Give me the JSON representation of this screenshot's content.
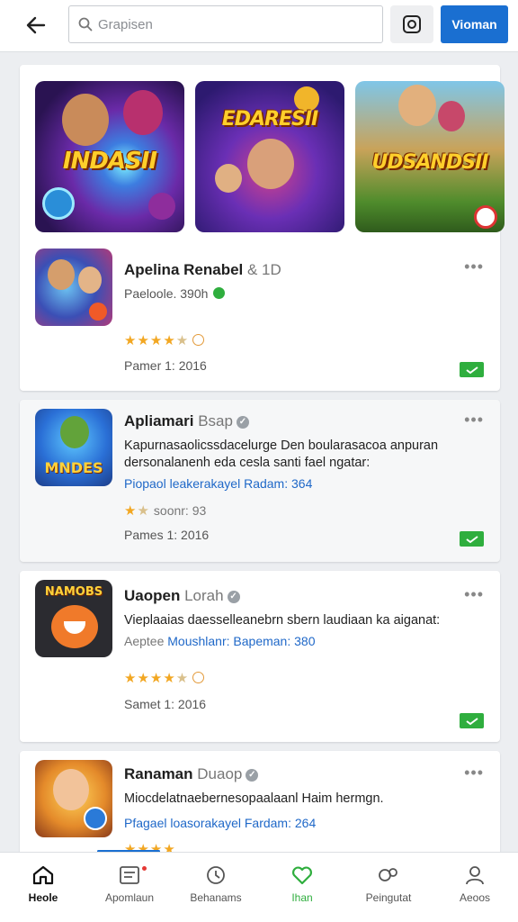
{
  "header": {
    "search_placeholder": "Grapisen",
    "action_label": "Vioman"
  },
  "featured": {
    "banners": [
      {
        "title": "INDASII"
      },
      {
        "title": "EDARESII"
      },
      {
        "title": "UDSANDSII"
      }
    ],
    "app": {
      "name": "Apelina Renabel",
      "name_suffix": "& 1D",
      "publisher": "Paeloole. 390h",
      "rating_value": 4.5,
      "date": "Pamer 1: 2016"
    }
  },
  "apps": [
    {
      "name": "Apliamari",
      "name_sub": "Bsap",
      "icon_text": "MNDES",
      "description": "Kapurnasaolicssdacelurge Den boularasacoa anpuran dersonalanenh eda cesla santi fael ngatar:",
      "link": "Piopaol leakerakayel Radam: 364",
      "link_prefix": "",
      "rating_value": 2,
      "rating_text": "soonr: 93",
      "date": "Pames 1: 2016"
    },
    {
      "name": "Uaopen",
      "name_sub": "Lorah",
      "icon_text": "NAMOBS",
      "description": "Vieplaaias daesselleanebrn sbern laudiaan ka aiganat:",
      "link": "Moushlanr: Bapeman: 380",
      "link_prefix": "Aeptee",
      "rating_value": 4.5,
      "rating_text": "",
      "date": "Samet 1: 2016"
    },
    {
      "name": "Ranaman",
      "name_sub": "Duaop",
      "icon_text": "",
      "description": "Miocdelatnaebernesopaalaanl Haim hermgn.",
      "link": "Pfagael loasorakayel Fardam: 264",
      "link_prefix": "",
      "rating_value": 4,
      "rating_text": "",
      "date": ""
    }
  ],
  "nav": [
    {
      "label": "Heole",
      "icon": "home-icon"
    },
    {
      "label": "Apomlaun",
      "icon": "list-icon"
    },
    {
      "label": "Behanams",
      "icon": "clock-icon"
    },
    {
      "label": "Ihan",
      "icon": "heart-icon"
    },
    {
      "label": "Peingutat",
      "icon": "group-icon"
    },
    {
      "label": "Aeoos",
      "icon": "person-icon"
    }
  ],
  "colors": {
    "accent": "#1a6fd1",
    "success": "#2fae3e",
    "star": "#f2a722",
    "link": "#1f68c8"
  }
}
